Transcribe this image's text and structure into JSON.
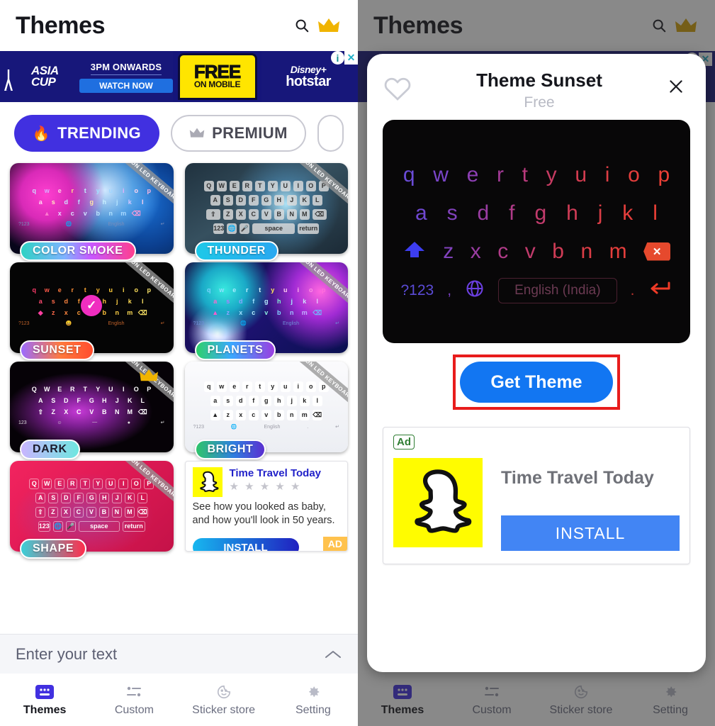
{
  "app": {
    "title": "Themes",
    "icons": {
      "search": "search-icon",
      "crown": "crown-icon"
    }
  },
  "top_ad": {
    "brand": "ASIA CUP",
    "line1": "3PM ONWARDS",
    "cta": "WATCH NOW",
    "phone_line1": "FREE",
    "phone_line2": "ON MOBILE",
    "partner_top": "Disney+",
    "partner_bottom": "hotstar",
    "info_icon": "i",
    "close_icon": "✕"
  },
  "filters": [
    {
      "label": "TRENDING",
      "icon": "flame-icon",
      "active": true
    },
    {
      "label": "PREMIUM",
      "icon": "crown-icon",
      "active": false
    },
    {
      "label": "",
      "icon": "",
      "active": false
    }
  ],
  "themes": [
    {
      "name": "COLOR SMOKE",
      "ribbon": "NEON LED KEYBOARD",
      "premium": false,
      "label_gradient": "linear-gradient(90deg,#2ed2c4,#7fb3ff 38%,#c957ff 62%,#ff3f8e)"
    },
    {
      "name": "THUNDER",
      "ribbon": "NEON LED KEYBOARD",
      "premium": false,
      "label_gradient": "linear-gradient(90deg,#1ec8e8,#2aa8f0)"
    },
    {
      "name": "SUNSET",
      "ribbon": "NEON LED KEYBOARD",
      "premium": false,
      "label_gradient": "linear-gradient(90deg,#9b6bff,#ff7a3d 55%,#ff4d2e)"
    },
    {
      "name": "PLANETS",
      "ribbon": "NEON LED KEYBOARD",
      "premium": false,
      "label_gradient": "linear-gradient(90deg,#2fd06a,#3ba8ff 45%,#9b3fe0)"
    },
    {
      "name": "DARK",
      "ribbon": "NEON LED KEYBOARD",
      "premium": true,
      "label_gradient": "linear-gradient(90deg,#c9b5ff,#6ee7e0)"
    },
    {
      "name": "BRIGHT",
      "ribbon": "NEON LED KEYBOARD",
      "premium": false,
      "label_gradient": "linear-gradient(90deg,#2fc46b,#2f7ee0 55%,#5a2fd0)"
    },
    {
      "name": "SHAPE",
      "ribbon": "NEON LED KEYBOARD",
      "premium": false,
      "label_gradient": "linear-gradient(90deg,#3bd0d8,#ff2e4d)"
    }
  ],
  "inline_ad": {
    "title": "Time Travel Today",
    "stars": "★ ★ ★ ★ ★",
    "body": "See how you looked as baby, and how you'll look in 50 years.",
    "install": "INSTALL",
    "tag": "AD"
  },
  "entry": {
    "placeholder": "Enter your text",
    "chevron": "chevron-up-icon"
  },
  "nav": [
    {
      "label": "Themes",
      "icon": "keyboard-icon",
      "active": true
    },
    {
      "label": "Custom",
      "icon": "sliders-icon",
      "active": false
    },
    {
      "label": "Sticker store",
      "icon": "sticker-face-icon",
      "active": false
    },
    {
      "label": "Setting",
      "icon": "gear-icon",
      "active": false
    }
  ],
  "modal": {
    "title": "Theme Sunset",
    "price": "Free",
    "favorite_icon": "heart-outline-icon",
    "close_icon": "close-icon",
    "cta": "Get Theme",
    "keyboard": {
      "row1": [
        "q",
        "w",
        "e",
        "r",
        "t",
        "y",
        "u",
        "i",
        "o",
        "p"
      ],
      "row2": [
        "a",
        "s",
        "d",
        "f",
        "g",
        "h",
        "j",
        "k",
        "l"
      ],
      "row3": [
        "z",
        "x",
        "c",
        "v",
        "b",
        "n",
        "m"
      ],
      "shift_icon": "shift-arrow-icon",
      "backspace_icon": "backspace-icon",
      "symbols_key": "?123",
      "comma_key": ",",
      "globe_icon": "globe-icon",
      "space_label": "English (India)",
      "period_key": ".",
      "enter_icon": "enter-arrow-icon"
    },
    "ad": {
      "badge": "Ad",
      "title": "Time Travel Today",
      "install": "INSTALL",
      "icon": "snapchat-ghost-icon"
    }
  },
  "colors": {
    "accent_chip": "#4130e0",
    "cta_blue": "#1276f2",
    "highlight_red": "#e81c1c",
    "install_blue": "#4285f4",
    "snapchat_yellow": "#FFFC00"
  }
}
